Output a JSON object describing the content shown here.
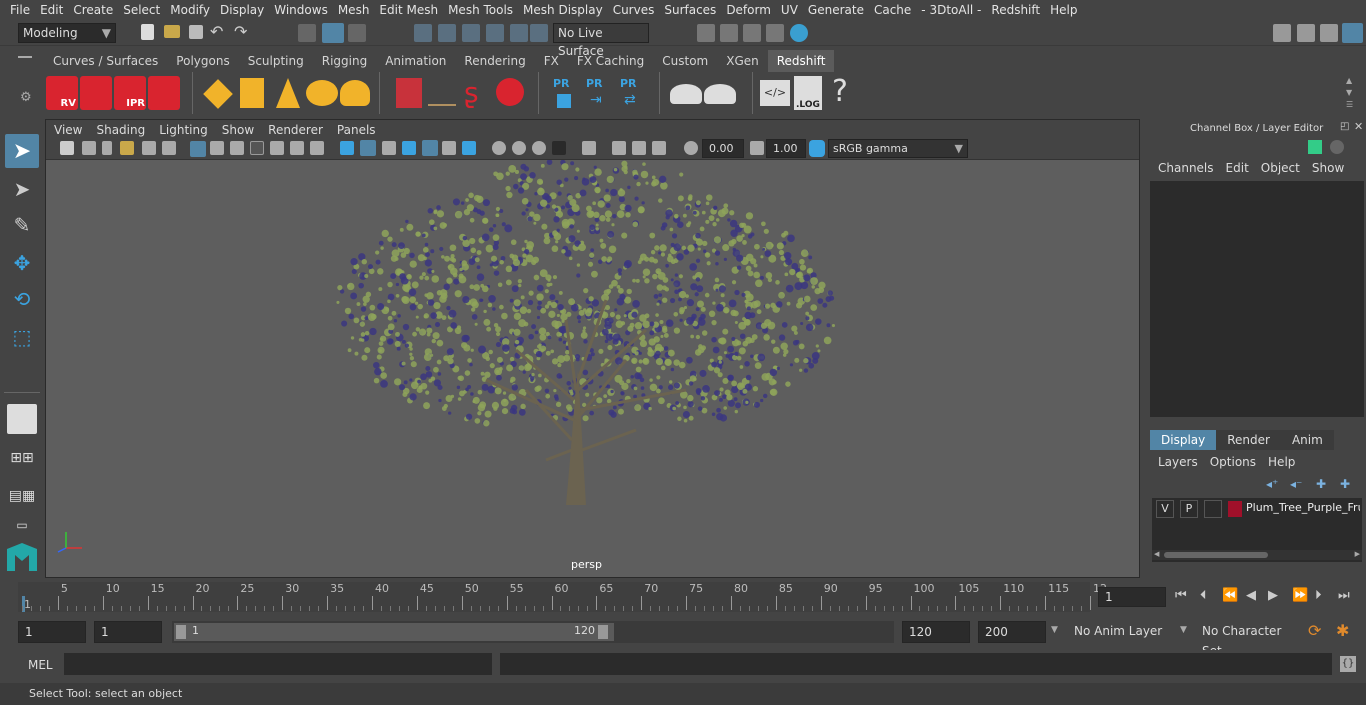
{
  "menubar": {
    "items": [
      "File",
      "Edit",
      "Create",
      "Select",
      "Modify",
      "Display",
      "Windows",
      "Mesh",
      "Edit Mesh",
      "Mesh Tools",
      "Mesh Display",
      "Curves",
      "Surfaces",
      "Deform",
      "UV",
      "Generate",
      "Cache",
      "- 3DtoAll -",
      "Redshift",
      "Help"
    ]
  },
  "statusline": {
    "mode": "Modeling",
    "live_surface": "No Live Surface"
  },
  "shelf": {
    "tabs": [
      "Curves / Surfaces",
      "Polygons",
      "Sculpting",
      "Rigging",
      "Animation",
      "Rendering",
      "FX",
      "FX Caching",
      "Custom",
      "XGen",
      "Redshift"
    ],
    "active_tab": "Redshift",
    "icon_labels": {
      "rv": "RV",
      "ipr": "IPR",
      "pr1": "PR",
      "pr2": "PR",
      "pr3": "PR",
      "log": ".LOG",
      "help": "?"
    }
  },
  "viewport": {
    "menus": [
      "View",
      "Shading",
      "Lighting",
      "Show",
      "Renderer",
      "Panels"
    ],
    "exposure": "0.00",
    "gamma": "1.00",
    "colorspace": "sRGB gamma",
    "camera_label": "persp"
  },
  "channel_box": {
    "title": "Channel Box / Layer Editor",
    "menus": [
      "Channels",
      "Edit",
      "Object",
      "Show"
    ],
    "tabs": [
      "Display",
      "Render",
      "Anim"
    ],
    "active_tab": "Display",
    "layer_menus": [
      "Layers",
      "Options",
      "Help"
    ],
    "layer": {
      "v": "V",
      "p": "P",
      "name": "Plum_Tree_Purple_Frui",
      "color": "#a0102a"
    }
  },
  "timeline": {
    "ticks": [
      "5",
      "10",
      "15",
      "20",
      "25",
      "30",
      "35",
      "40",
      "45",
      "50",
      "55",
      "60",
      "65",
      "70",
      "75",
      "80",
      "85",
      "90",
      "95",
      "100",
      "105",
      "110",
      "115",
      "12"
    ],
    "start_marker": "1",
    "current_frame": "1"
  },
  "range": {
    "start": "1",
    "playback_start": "1",
    "slider_start": "1",
    "slider_end": "120",
    "playback_end": "120",
    "end": "200",
    "anim_layer": "No Anim Layer",
    "character_set": "No Character Set"
  },
  "command": {
    "label": "MEL"
  },
  "help_line": {
    "text": "Select Tool: select an object"
  },
  "colors": {
    "accent": "#5285a6",
    "redshift": "#d9242f",
    "fruit": "#3b3680",
    "leaf": "#8ea35a",
    "trunk": "#6b6350"
  }
}
